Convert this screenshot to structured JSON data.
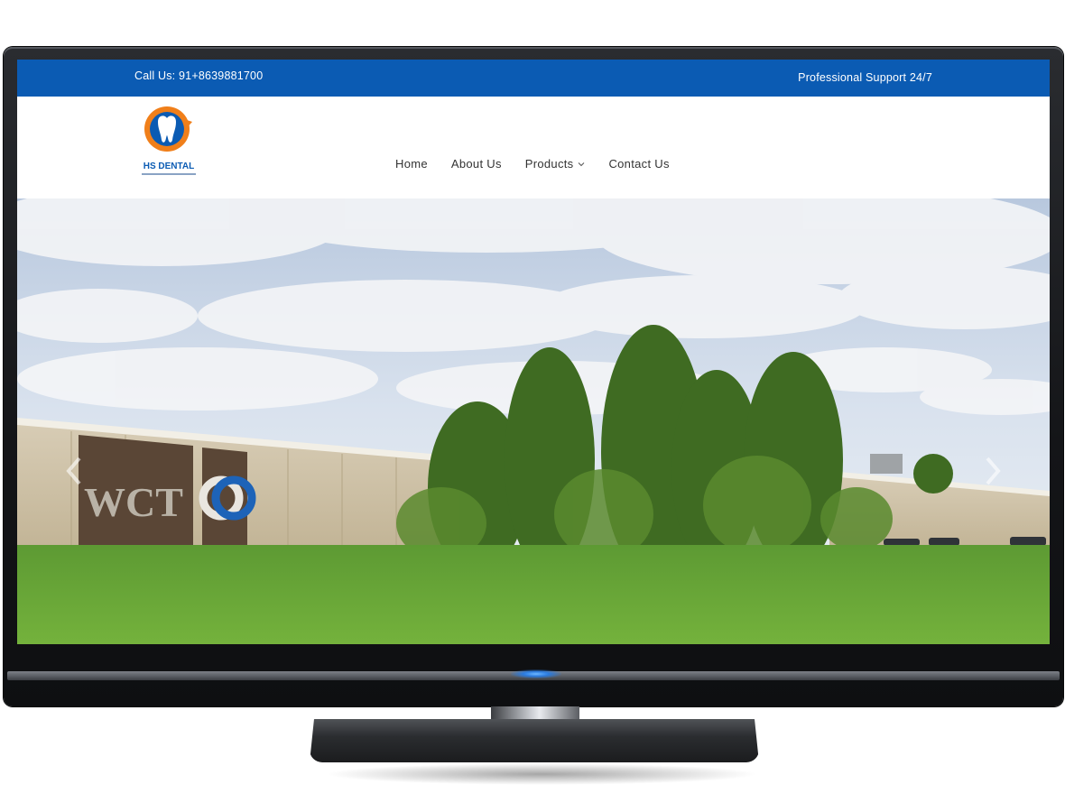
{
  "topbar": {
    "call": "Call Us: 91+8639881700",
    "support": "Professional Support 24/7"
  },
  "brand": {
    "name": "HS DENTAL",
    "colors": {
      "blue": "#0b5bb3",
      "orange": "#f07f1a"
    }
  },
  "nav": {
    "items": [
      {
        "label": "Home"
      },
      {
        "label": "About Us"
      },
      {
        "label": "Products"
      },
      {
        "label": "Contact Us"
      }
    ]
  },
  "hero": {
    "sign_left": "WCT",
    "sign_right": "C",
    "prev_icon": "chevron-left-icon",
    "next_icon": "chevron-right-icon"
  }
}
